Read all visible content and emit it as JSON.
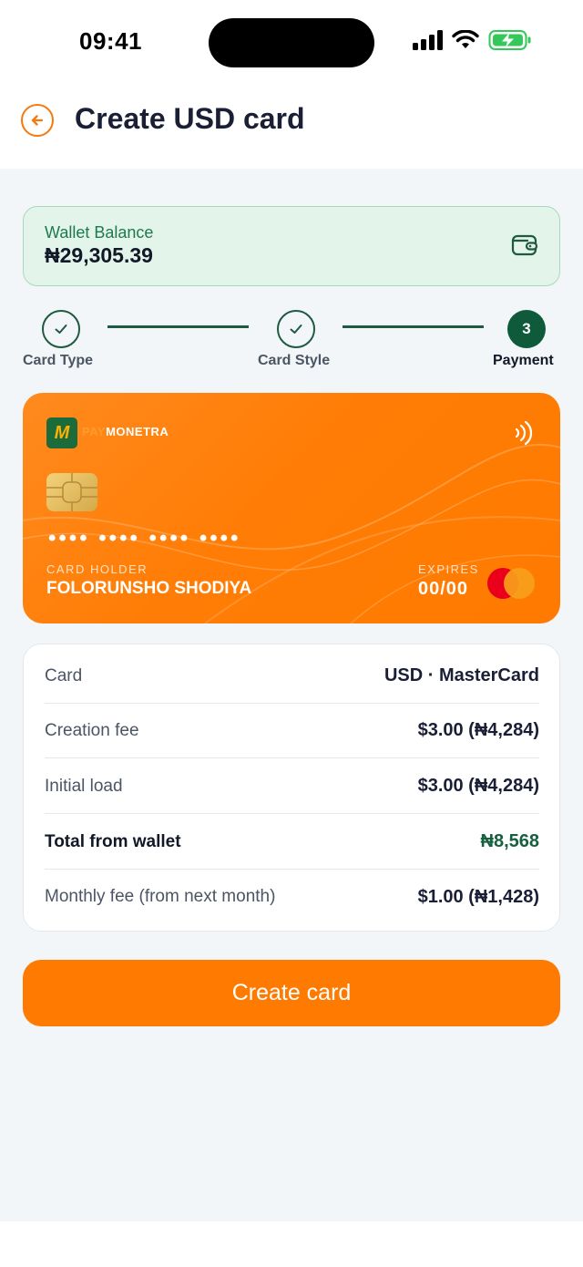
{
  "status": {
    "time": "09:41"
  },
  "header": {
    "title": "Create USD card"
  },
  "wallet": {
    "label": "Wallet Balance",
    "value": "₦29,305.39"
  },
  "steps": [
    {
      "label": "Card Type",
      "state": "done"
    },
    {
      "label": "Card Style",
      "state": "done"
    },
    {
      "label": "Payment",
      "state": "active",
      "number": "3"
    }
  ],
  "card": {
    "brand_pay": "PAY",
    "brand_name": "MONETRA",
    "logo_letter": "M",
    "number_mask": "•••• •••• •••• ••••",
    "holder_label": "CARD HOLDER",
    "holder_name": "FOLORUNSHO SHODIYA",
    "expires_label": "EXPIRES",
    "expires_value": "00/00"
  },
  "summary": {
    "rows": [
      {
        "label": "Card",
        "value": "USD · MasterCard"
      },
      {
        "label": "Creation fee",
        "value": "$3.00 (₦4,284)"
      },
      {
        "label": "Initial load",
        "value": "$3.00 (₦4,284)"
      },
      {
        "label": "Total from wallet",
        "value": "₦8,568"
      },
      {
        "label": "Monthly fee (from next month)",
        "value": "$1.00 (₦1,428)"
      }
    ]
  },
  "cta": {
    "label": "Create card"
  },
  "colors": {
    "accent": "#FF7A00",
    "green": "#0F5A3A"
  }
}
